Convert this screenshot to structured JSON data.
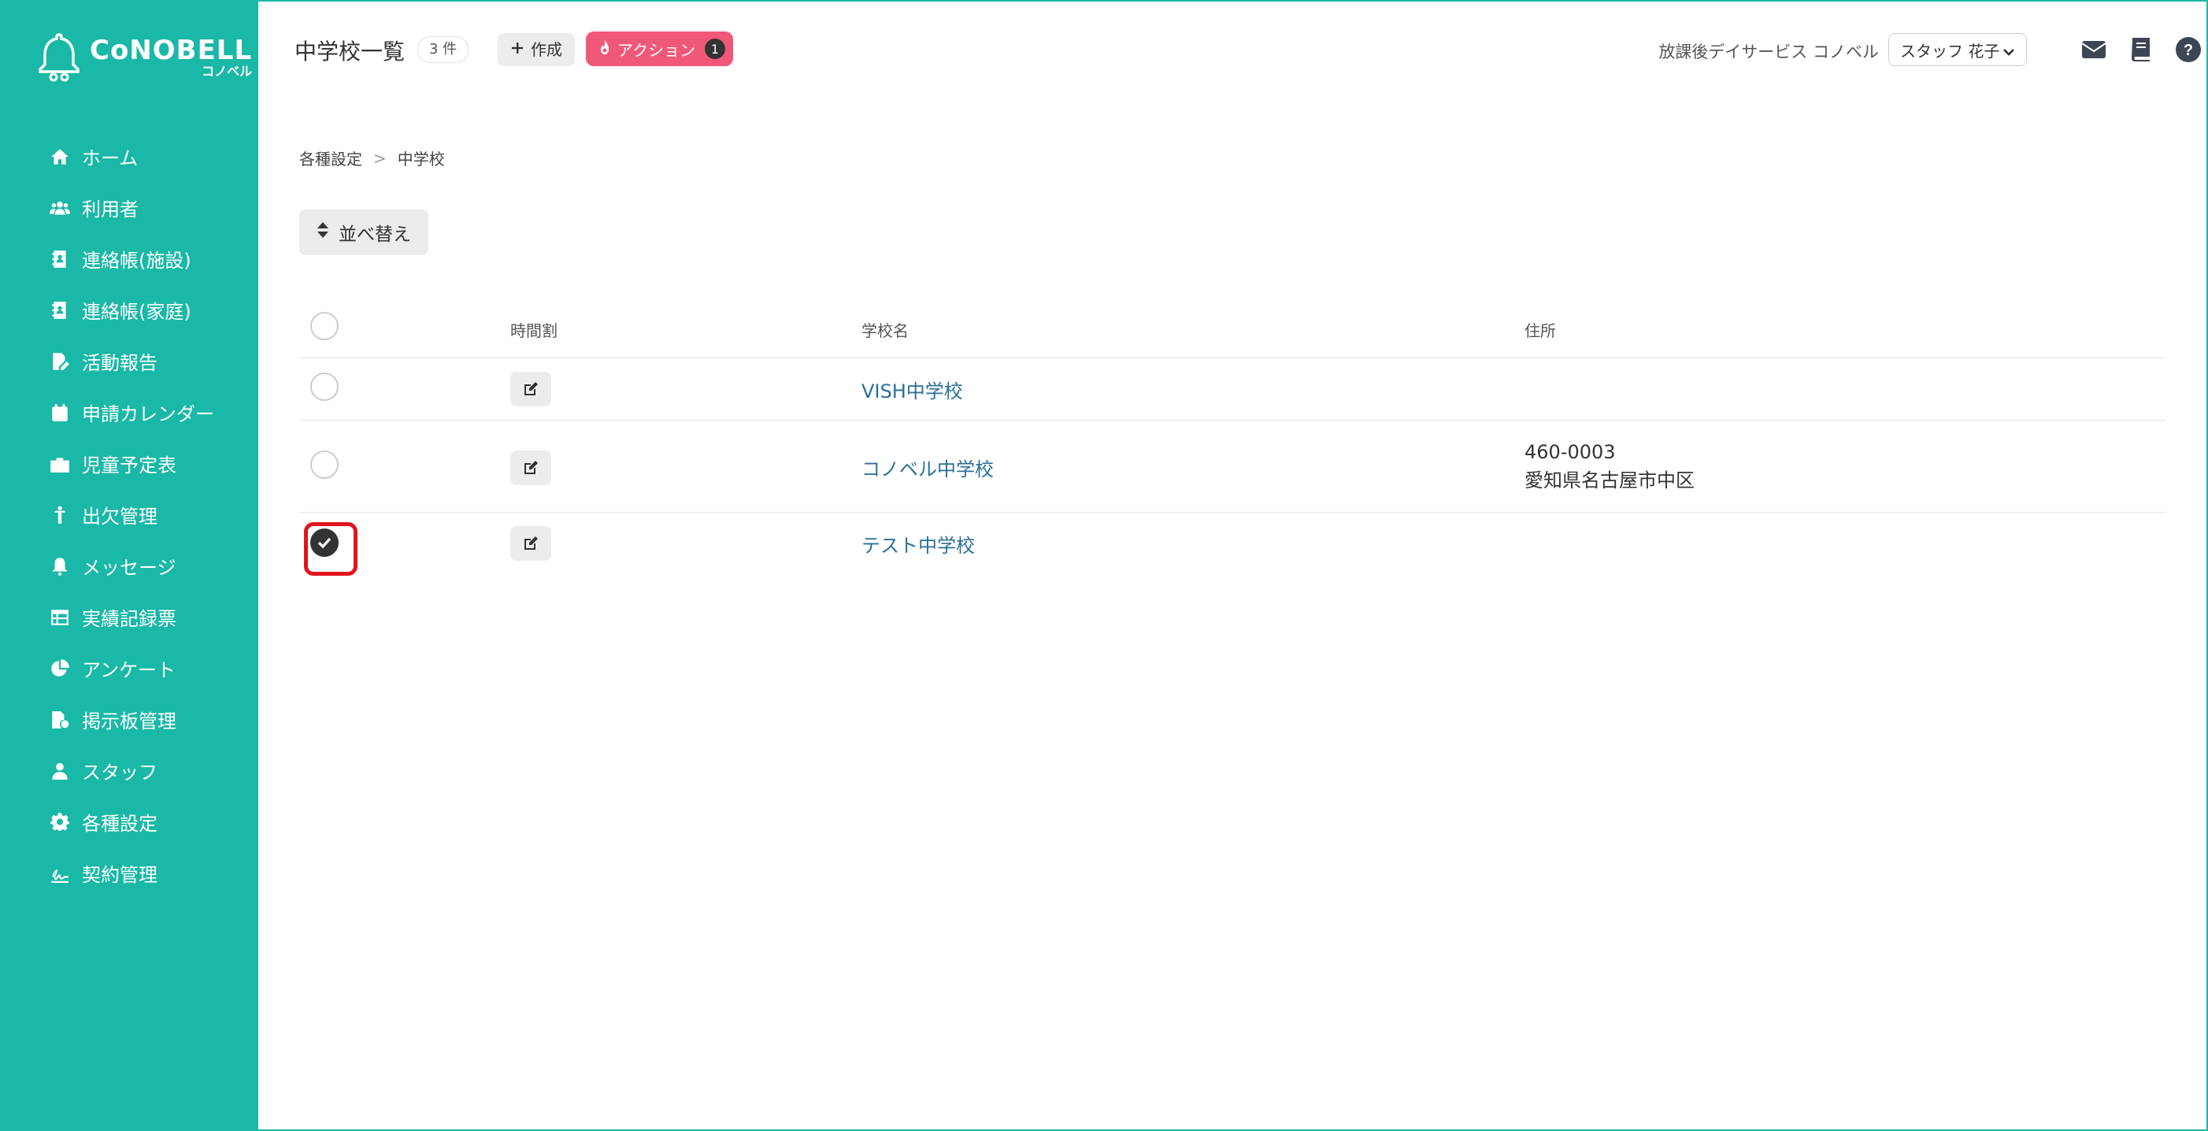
{
  "app": {
    "logo_text": "CoNOBELL",
    "logo_sub": "コノベル"
  },
  "sidebar": {
    "items": [
      {
        "label": "ホーム",
        "icon": "home-icon"
      },
      {
        "label": "利用者",
        "icon": "users-icon"
      },
      {
        "label": "連絡帳(施設)",
        "icon": "contact-book-icon"
      },
      {
        "label": "連絡帳(家庭)",
        "icon": "contact-book-icon"
      },
      {
        "label": "活動報告",
        "icon": "report-icon"
      },
      {
        "label": "申請カレンダー",
        "icon": "calendar-icon"
      },
      {
        "label": "児童予定表",
        "icon": "schedule-icon"
      },
      {
        "label": "出欠管理",
        "icon": "attendance-icon"
      },
      {
        "label": "メッセージ",
        "icon": "bell-icon"
      },
      {
        "label": "実績記録票",
        "icon": "table-icon"
      },
      {
        "label": "アンケート",
        "icon": "pie-chart-icon"
      },
      {
        "label": "掲示板管理",
        "icon": "board-icon"
      },
      {
        "label": "スタッフ",
        "icon": "staff-icon"
      },
      {
        "label": "各種設定",
        "icon": "gear-icon"
      },
      {
        "label": "契約管理",
        "icon": "contract-icon"
      }
    ]
  },
  "header": {
    "title": "中学校一覧",
    "count": "3 件",
    "create_label": "作成",
    "action_label": "アクション",
    "action_count": "1",
    "facility_name": "放課後デイサービス コノベル",
    "staff_name": "スタッフ 花子"
  },
  "breadcrumb": {
    "parent": "各種設定",
    "separator": ">",
    "current": "中学校"
  },
  "toolbar": {
    "sort_label": "並べ替え"
  },
  "table": {
    "headers": {
      "timetable": "時間割",
      "school_name": "学校名",
      "address": "住所"
    },
    "rows": [
      {
        "school_name": "VISH中学校",
        "postal": "",
        "address": "",
        "checked": false
      },
      {
        "school_name": "コノベル中学校",
        "postal": "460-0003",
        "address": "愛知県名古屋市中区",
        "checked": false
      },
      {
        "school_name": "テスト中学校",
        "postal": "",
        "address": "",
        "checked": true
      }
    ]
  },
  "colors": {
    "brand": "#1ab8a6",
    "action": "#f0587a",
    "link": "#2a6f9a",
    "highlight": "#e0141e"
  }
}
